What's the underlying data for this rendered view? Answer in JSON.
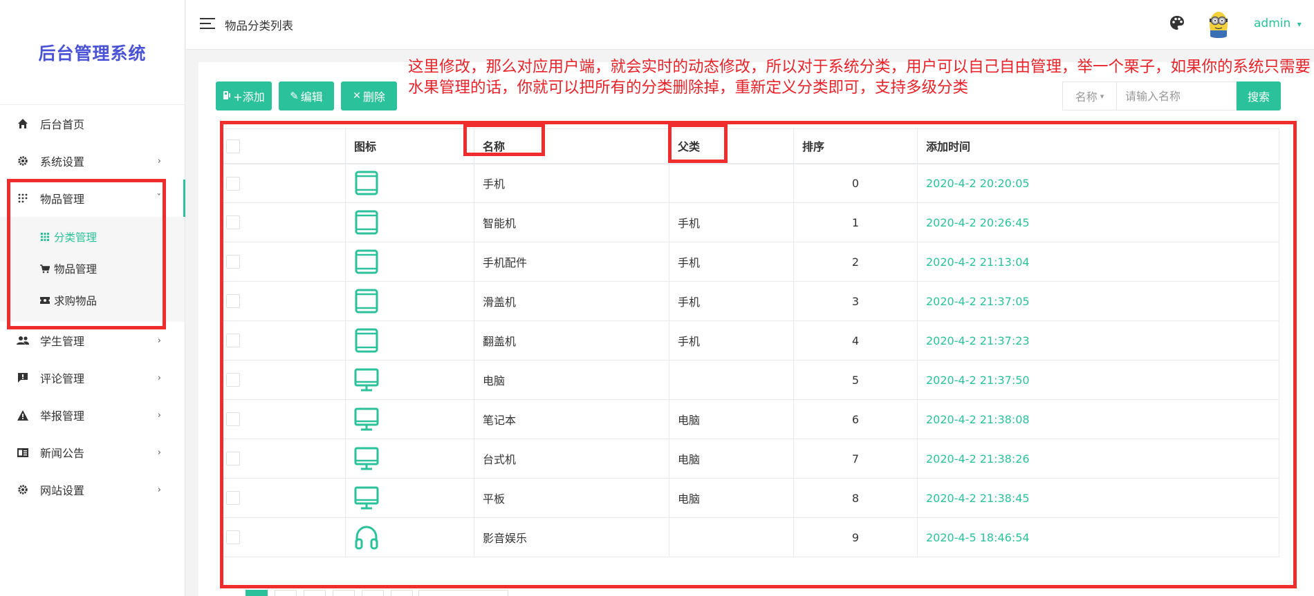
{
  "brand": {
    "title": "后台管理系统"
  },
  "sidebar": {
    "items": [
      {
        "label": "后台首页",
        "icon": "home-icon",
        "has_arrow": false
      },
      {
        "label": "系统设置",
        "icon": "gear-icon",
        "has_arrow": true
      },
      {
        "label": "物品管理",
        "icon": "grid-dots-icon",
        "has_arrow": true,
        "expanded": true
      },
      {
        "label": "学生管理",
        "icon": "people-icon",
        "has_arrow": true
      },
      {
        "label": "评论管理",
        "icon": "comment-icon",
        "has_arrow": true
      },
      {
        "label": "举报管理",
        "icon": "warning-icon",
        "has_arrow": true
      },
      {
        "label": "新闻公告",
        "icon": "news-icon",
        "has_arrow": true
      },
      {
        "label": "网站设置",
        "icon": "gear-icon",
        "has_arrow": true
      }
    ],
    "chevron_right": "›",
    "chevron_down": "ˇ",
    "sub_items": [
      {
        "label": "分类管理",
        "icon": "grid-icon",
        "current": true
      },
      {
        "label": "物品管理",
        "icon": "cart-icon",
        "current": false
      },
      {
        "label": "求购物品",
        "icon": "ticket-icon",
        "current": false
      }
    ]
  },
  "topbar": {
    "breadcrumb": "物品分类列表",
    "user": "admin",
    "user_caret": "▾"
  },
  "toolbar": {
    "add_label": "+添加",
    "edit_label": "编辑",
    "delete_label": "删除",
    "delete_glyph": "✕",
    "edit_glyph": "✎"
  },
  "search": {
    "field_label": "名称",
    "field_caret": "▾",
    "placeholder": "请输入名称",
    "button_label": "搜索"
  },
  "table": {
    "headers": [
      "图标",
      "名称",
      "父类",
      "排序",
      "添加时间"
    ],
    "rows": [
      {
        "icon": "tablet-icon",
        "name": "手机",
        "parent": "",
        "sort": "0",
        "time": "2020-4-2 20:20:05"
      },
      {
        "icon": "tablet-icon",
        "name": "智能机",
        "parent": "手机",
        "sort": "1",
        "time": "2020-4-2 20:26:45"
      },
      {
        "icon": "tablet-icon",
        "name": "手机配件",
        "parent": "手机",
        "sort": "2",
        "time": "2020-4-2 21:13:04"
      },
      {
        "icon": "tablet-icon",
        "name": "滑盖机",
        "parent": "手机",
        "sort": "3",
        "time": "2020-4-2 21:37:05"
      },
      {
        "icon": "tablet-icon",
        "name": "翻盖机",
        "parent": "手机",
        "sort": "4",
        "time": "2020-4-2 21:37:23"
      },
      {
        "icon": "monitor-icon",
        "name": "电脑",
        "parent": "",
        "sort": "5",
        "time": "2020-4-2 21:37:50"
      },
      {
        "icon": "monitor-icon",
        "name": "笔记本",
        "parent": "电脑",
        "sort": "6",
        "time": "2020-4-2 21:38:08"
      },
      {
        "icon": "monitor-icon",
        "name": "台式机",
        "parent": "电脑",
        "sort": "7",
        "time": "2020-4-2 21:38:26"
      },
      {
        "icon": "monitor-icon",
        "name": "平板",
        "parent": "电脑",
        "sort": "8",
        "time": "2020-4-2 21:38:45"
      },
      {
        "icon": "headphones-icon",
        "name": "影音娱乐",
        "parent": "",
        "sort": "9",
        "time": "2020-4-5 18:46:54"
      }
    ]
  },
  "annotation": {
    "text": "这里修改，那么对应用户端，就会实时的动态修改，所以对于系统分类，用户可以自己自由管理，举一个栗子，如果你的系统只需要水果管理的话，你就可以把所有的分类删除掉，重新定义分类即可，支持多级分类"
  },
  "colors": {
    "accent": "#2bc29b",
    "brand": "#4a53d6",
    "annotation_red": "#ef2d2d"
  }
}
